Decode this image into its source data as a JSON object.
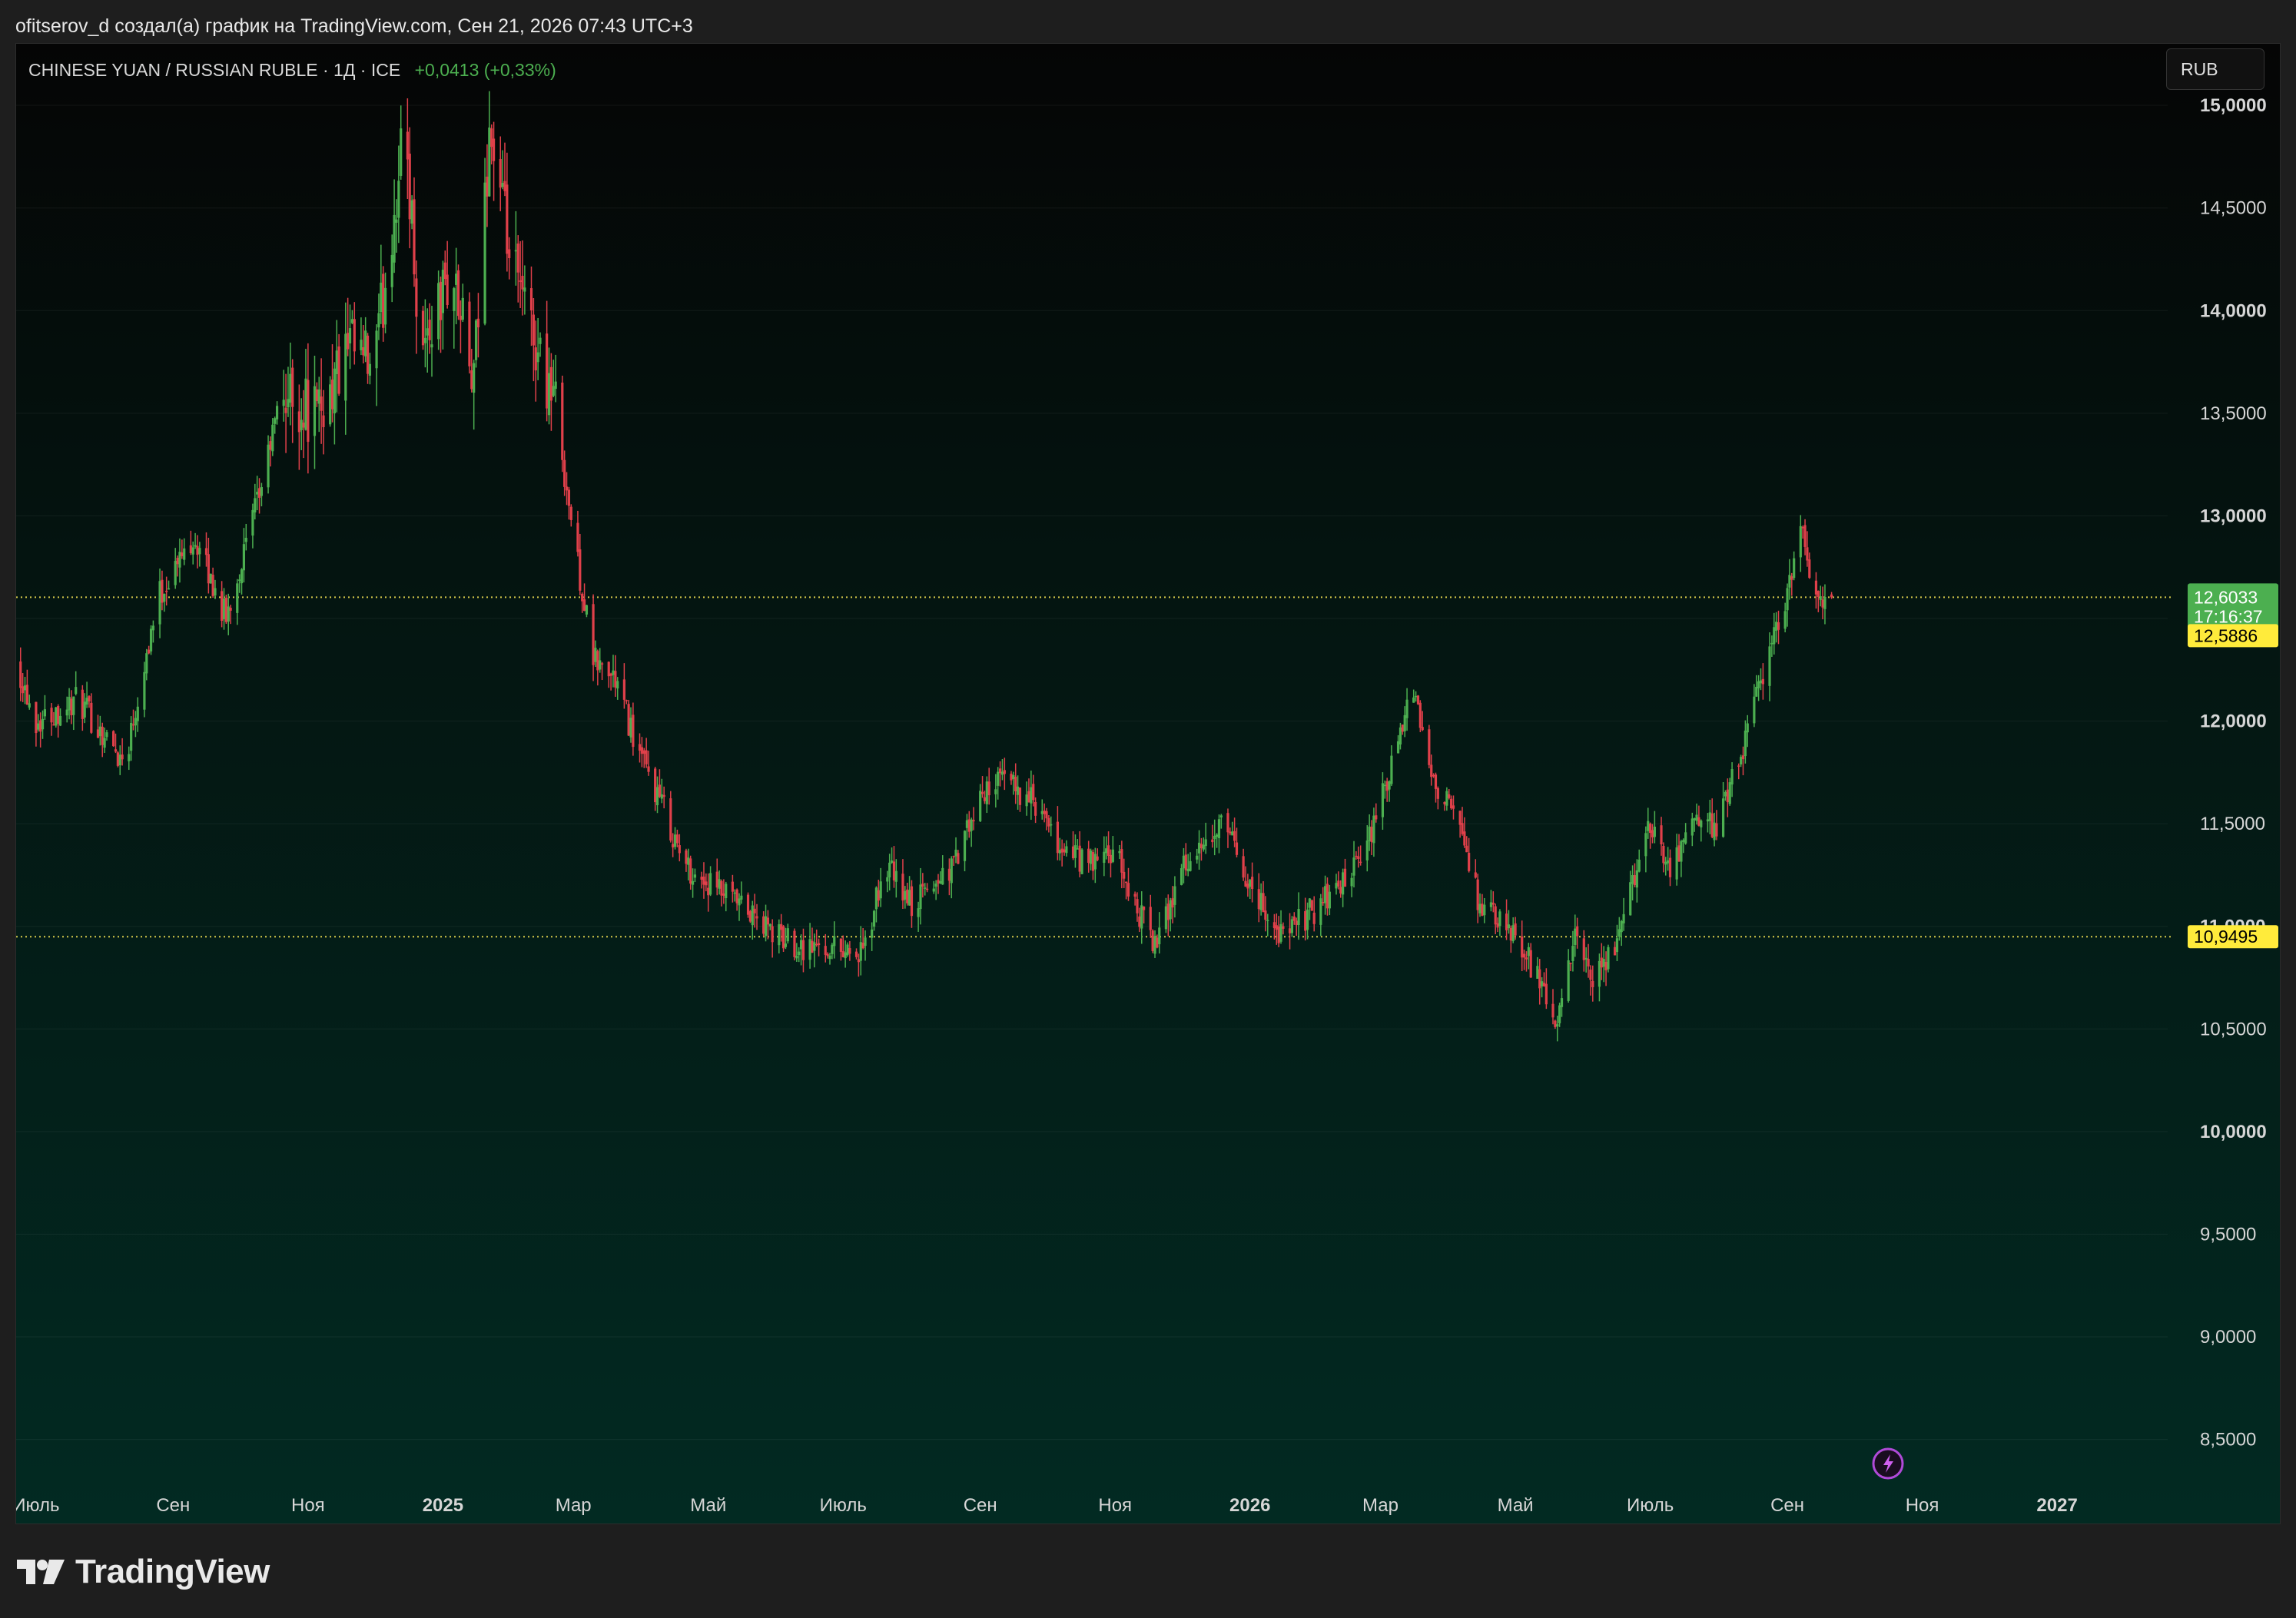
{
  "header": {
    "credit": "ofitserov_d создал(а) график на TradingView.com, Сен 21, 2026 07:43 UTC+3"
  },
  "legend": {
    "symbol": "CHINESE YUAN / RUSSIAN RUBLE · 1Д · ICE",
    "change": "+0,0413 (+0,33%)"
  },
  "currency_button": {
    "label": "RUB"
  },
  "footer": {
    "brand": "TradingView"
  },
  "colors": {
    "up": "#4caf50",
    "down": "#e0404a",
    "last_price_badge": "#4caf50",
    "level_badge": "#ffeb3b",
    "reference_line": "#d4c84a"
  },
  "chart_data": {
    "type": "candlestick",
    "interval": "1D",
    "ylim": [
      8.3,
      15.3
    ],
    "y_ticks": [
      {
        "value": 8.5,
        "label": "8,5000"
      },
      {
        "value": 9.0,
        "label": "9,0000"
      },
      {
        "value": 9.5,
        "label": "9,5000"
      },
      {
        "value": 10.0,
        "label": "10,0000"
      },
      {
        "value": 10.5,
        "label": "10,5000"
      },
      {
        "value": 11.0,
        "label": "11,0000"
      },
      {
        "value": 11.5,
        "label": "11,5000"
      },
      {
        "value": 12.0,
        "label": "12,0000"
      },
      {
        "value": 12.5,
        "label": "12,5000"
      },
      {
        "value": 13.0,
        "label": "13,0000"
      },
      {
        "value": 13.5,
        "label": "13,5000"
      },
      {
        "value": 14.0,
        "label": "14,0000"
      },
      {
        "value": 14.5,
        "label": "14,5000"
      },
      {
        "value": 15.0,
        "label": "15,0000"
      }
    ],
    "bold_y_ticks": [
      10.0,
      11.0,
      12.0,
      13.0,
      14.0,
      15.0
    ],
    "xlim": [
      "2024-06-22",
      "2027-02-20"
    ],
    "x_ticks": [
      {
        "date": "2024-07-01",
        "label": "Июль",
        "bold": false
      },
      {
        "date": "2024-09-01",
        "label": "Сен",
        "bold": false
      },
      {
        "date": "2024-11-01",
        "label": "Ноя",
        "bold": false
      },
      {
        "date": "2025-01-01",
        "label": "2025",
        "bold": true
      },
      {
        "date": "2025-03-01",
        "label": "Мар",
        "bold": false
      },
      {
        "date": "2025-05-01",
        "label": "Май",
        "bold": false
      },
      {
        "date": "2025-07-01",
        "label": "Июль",
        "bold": false
      },
      {
        "date": "2025-09-01",
        "label": "Сен",
        "bold": false
      },
      {
        "date": "2025-11-01",
        "label": "Ноя",
        "bold": false
      },
      {
        "date": "2026-01-01",
        "label": "2026",
        "bold": true
      },
      {
        "date": "2026-03-01",
        "label": "Мар",
        "bold": false
      },
      {
        "date": "2026-05-01",
        "label": "Май",
        "bold": false
      },
      {
        "date": "2026-07-01",
        "label": "Июль",
        "bold": false
      },
      {
        "date": "2026-09-01",
        "label": "Сен",
        "bold": false
      },
      {
        "date": "2026-11-01",
        "label": "Ноя",
        "bold": false
      },
      {
        "date": "2027-01-01",
        "label": "2027",
        "bold": true
      }
    ],
    "approx_close_path": [
      [
        "2024-06-22",
        12.3
      ],
      [
        "2024-07-01",
        12.0
      ],
      [
        "2024-07-20",
        12.1
      ],
      [
        "2024-08-10",
        11.8
      ],
      [
        "2024-08-25",
        12.6
      ],
      [
        "2024-09-10",
        12.9
      ],
      [
        "2024-09-25",
        12.5
      ],
      [
        "2024-10-10",
        13.1
      ],
      [
        "2024-10-20",
        13.6
      ],
      [
        "2024-11-05",
        13.5
      ],
      [
        "2024-11-20",
        13.8
      ],
      [
        "2024-12-01",
        13.7
      ],
      [
        "2024-12-10",
        14.5
      ],
      [
        "2024-12-15",
        14.9
      ],
      [
        "2024-12-22",
        13.8
      ],
      [
        "2025-01-05",
        14.2
      ],
      [
        "2025-01-15",
        13.6
      ],
      [
        "2025-01-22",
        14.9
      ],
      [
        "2025-02-01",
        14.2
      ],
      [
        "2025-02-10",
        13.9
      ],
      [
        "2025-02-20",
        13.6
      ],
      [
        "2025-03-01",
        12.9
      ],
      [
        "2025-03-10",
        12.3
      ],
      [
        "2025-03-20",
        12.2
      ],
      [
        "2025-04-01",
        11.8
      ],
      [
        "2025-04-10",
        11.6
      ],
      [
        "2025-04-20",
        11.3
      ],
      [
        "2025-05-01",
        11.2
      ],
      [
        "2025-05-15",
        11.1
      ],
      [
        "2025-06-01",
        10.95
      ],
      [
        "2025-06-15",
        10.9
      ],
      [
        "2025-07-01",
        10.9
      ],
      [
        "2025-07-10",
        10.85
      ],
      [
        "2025-07-20",
        11.3
      ],
      [
        "2025-08-01",
        11.1
      ],
      [
        "2025-08-20",
        11.3
      ],
      [
        "2025-09-05",
        11.7
      ],
      [
        "2025-09-15",
        11.7
      ],
      [
        "2025-09-25",
        11.6
      ],
      [
        "2025-10-05",
        11.4
      ],
      [
        "2025-10-20",
        11.3
      ],
      [
        "2025-11-01",
        11.35
      ],
      [
        "2025-11-10",
        11.1
      ],
      [
        "2025-11-20",
        10.9
      ],
      [
        "2025-12-01",
        11.3
      ],
      [
        "2025-12-10",
        11.35
      ],
      [
        "2025-12-20",
        11.5
      ],
      [
        "2026-01-01",
        11.2
      ],
      [
        "2026-01-15",
        10.95
      ],
      [
        "2026-02-01",
        11.1
      ],
      [
        "2026-02-20",
        11.3
      ],
      [
        "2026-03-10",
        11.9
      ],
      [
        "2026-03-15",
        12.2
      ],
      [
        "2026-03-22",
        11.8
      ],
      [
        "2026-04-05",
        11.5
      ],
      [
        "2026-04-15",
        11.1
      ],
      [
        "2026-04-25",
        11.0
      ],
      [
        "2026-05-05",
        10.9
      ],
      [
        "2026-05-20",
        10.5
      ],
      [
        "2026-05-28",
        10.95
      ],
      [
        "2026-06-05",
        10.7
      ],
      [
        "2026-06-15",
        10.9
      ],
      [
        "2026-06-25",
        11.3
      ],
      [
        "2026-07-01",
        11.5
      ],
      [
        "2026-07-10",
        11.3
      ],
      [
        "2026-07-20",
        11.5
      ],
      [
        "2026-08-01",
        11.5
      ],
      [
        "2026-08-10",
        11.8
      ],
      [
        "2026-08-20",
        12.2
      ],
      [
        "2026-08-30",
        12.55
      ],
      [
        "2026-09-08",
        12.95
      ],
      [
        "2026-09-14",
        12.55
      ],
      [
        "2026-09-21",
        12.6033
      ]
    ],
    "candles_drawn_until": "2026-09-21",
    "last_price": {
      "value": 12.6033,
      "label": "12,6033",
      "countdown": "17:16:37"
    },
    "levels": [
      {
        "value": 12.5886,
        "label": "12,5886"
      },
      {
        "value": 10.9495,
        "label": "10,9495"
      }
    ]
  }
}
